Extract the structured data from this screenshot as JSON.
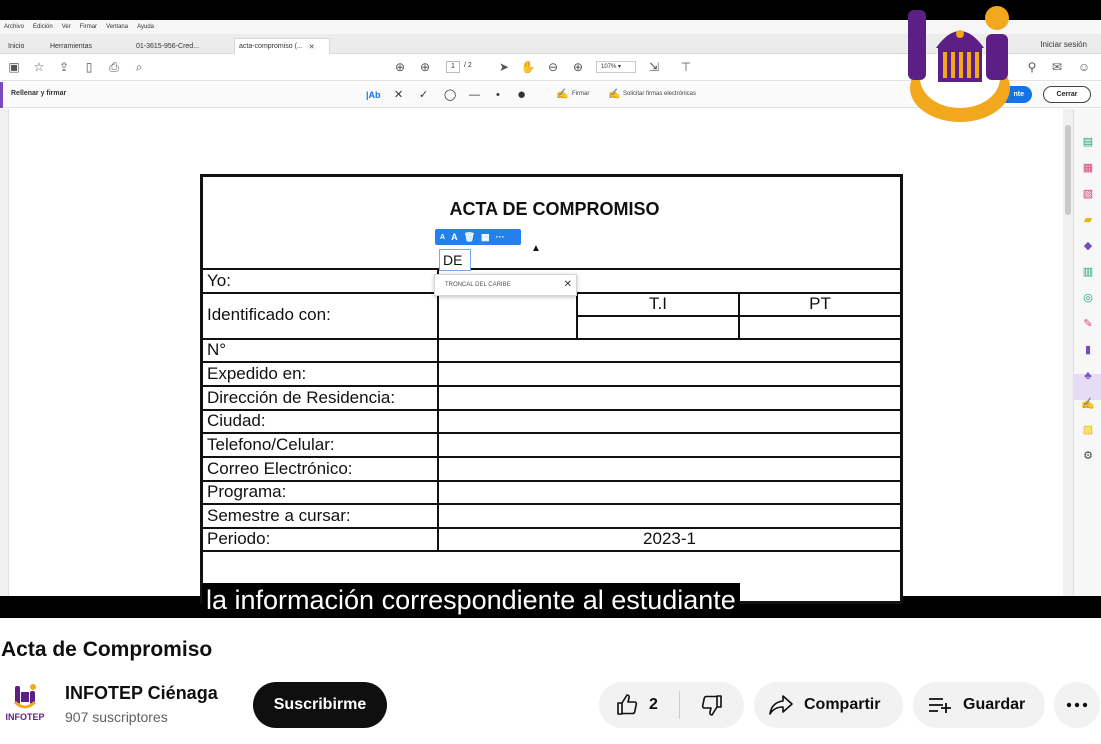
{
  "acrobat": {
    "menu": [
      "Archivo",
      "Edición",
      "Ver",
      "Firmar",
      "Ventana",
      "Ayuda"
    ],
    "tabs": [
      {
        "label": "Inicio"
      },
      {
        "label": "Herramientas"
      },
      {
        "label": "01-3615-956-Cred..."
      },
      {
        "label": "acta-compromiso (..."
      }
    ],
    "signin": "Iniciar sesión",
    "page_current": "1",
    "page_total": "/ 2",
    "zoom": "107%",
    "fill_sign_label": "Rellenar y firmar",
    "sign_label": "Firmar",
    "request_signatures_label": "Solicitar firmas electrónicas",
    "blue_button_label": "nte",
    "close_label": "Cerrar"
  },
  "form": {
    "title": "ACTA DE COMPROMISO",
    "fields": [
      {
        "label": "Yo:"
      },
      {
        "label": "Identificado con:"
      },
      {
        "label": "N°"
      },
      {
        "label": "Expedido en:"
      },
      {
        "label": "Dirección de Residencia:"
      },
      {
        "label": "Ciudad:"
      },
      {
        "label": "Telefono/Celular:"
      },
      {
        "label": "Correo Electrónico:"
      },
      {
        "label": "Programa:"
      },
      {
        "label": "Semestre a cursar:"
      },
      {
        "label": "Periodo:"
      }
    ],
    "id_options": [
      "T.I",
      "PT"
    ],
    "periodo_value": "2023-1",
    "typed_value": "DE",
    "suggestion": "TRONCAL DEL CARIBE",
    "mini_toolbar": [
      "A",
      "A"
    ]
  },
  "caption": "la información correspondiente al estudiante",
  "video": {
    "title": "Acta de Compromiso",
    "channel_name": "INFOTEP Ciénaga",
    "channel_avatar_text": "INFOTEP",
    "subscribers": "907 suscriptores",
    "subscribe_label": "Suscribirme",
    "likes": "2",
    "share_label": "Compartir",
    "save_label": "Guardar"
  },
  "colors": {
    "acrobat_accent": "#7a4bbd",
    "acrobat_blue": "#1473e6",
    "logo_purple": "#5b1f86",
    "logo_yellow": "#f2a81d"
  }
}
